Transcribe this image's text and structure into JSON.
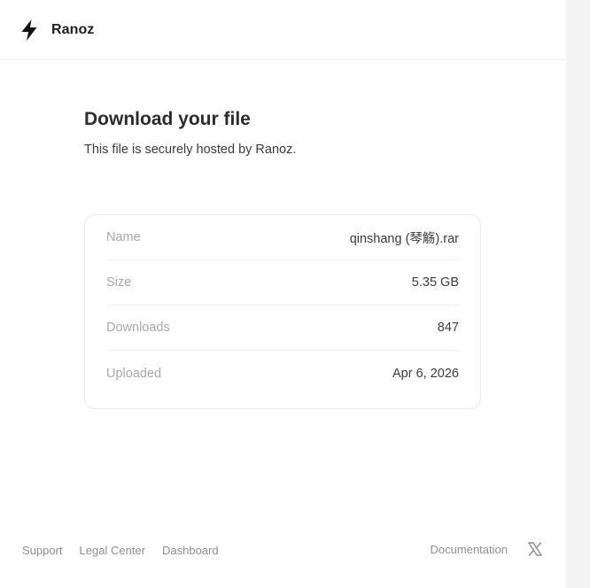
{
  "header": {
    "brand_name": "Ranoz",
    "brand_icon": "lightning-bolt-icon"
  },
  "main": {
    "title": "Download your file",
    "subtitle": "This file is securely hosted by Ranoz."
  },
  "file_details": [
    {
      "label": "Name",
      "value": "qinshang (琴觞).rar"
    },
    {
      "label": "Size",
      "value": "5.35 GB"
    },
    {
      "label": "Downloads",
      "value": "847"
    },
    {
      "label": "Uploaded",
      "value": "Apr 6, 2026"
    }
  ],
  "footer": {
    "links": [
      "Support",
      "Legal Center",
      "Dashboard"
    ],
    "right_link": "Documentation",
    "social_icon": "x-twitter-icon"
  },
  "colors": {
    "background": "#ffffff",
    "muted_label": "#a7a7ad",
    "value_text": "#3b3b40",
    "border": "#ececee"
  }
}
